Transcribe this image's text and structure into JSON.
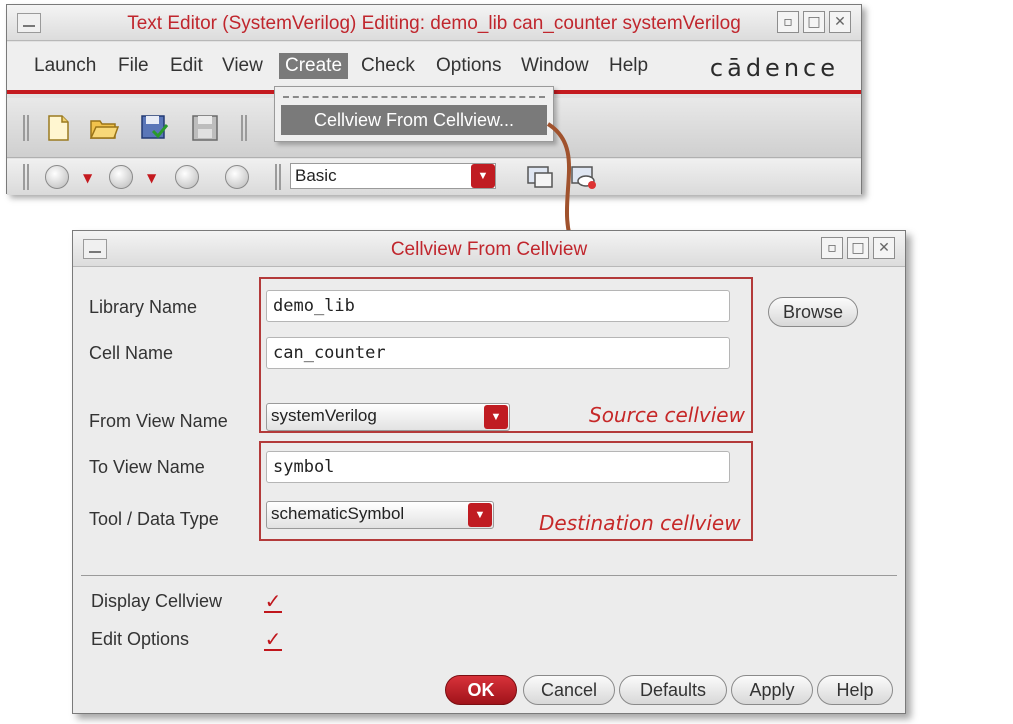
{
  "editor": {
    "title": "Text Editor (SystemVerilog) Editing: demo_lib can_counter systemVerilog",
    "menus": [
      "Launch",
      "File",
      "Edit",
      "View",
      "Create",
      "Check",
      "Options",
      "Window",
      "Help"
    ],
    "active_menu": "Create",
    "brand": "cādence",
    "workspace": "Basic"
  },
  "create_menu": {
    "items": [
      "Cellview From Cellview..."
    ]
  },
  "dialog": {
    "title": "Cellview From Cellview",
    "library_label": "Library Name",
    "library_value": "demo_lib",
    "browse_label": "Browse",
    "cell_label": "Cell Name",
    "cell_value": "can_counter",
    "from_view_label": "From View Name",
    "from_view_value": "systemVerilog",
    "to_view_label": "To View Name",
    "to_view_value": "symbol",
    "tool_label": "Tool / Data Type",
    "tool_value": "schematicSymbol",
    "display_cellview_label": "Display Cellview",
    "display_cellview_checked": true,
    "edit_options_label": "Edit Options",
    "edit_options_checked": true,
    "buttons": {
      "ok": "OK",
      "cancel": "Cancel",
      "defaults": "Defaults",
      "apply": "Apply",
      "help": "Help"
    }
  },
  "annotations": {
    "source": "Source cellview",
    "destination": "Destination cellview"
  },
  "colors": {
    "accent": "#c41a1f",
    "annotation": "#c62828"
  }
}
